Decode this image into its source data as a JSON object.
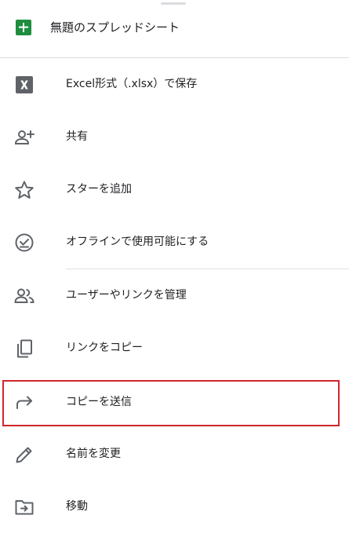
{
  "header": {
    "title": "無題のスプレッドシート",
    "icon": "google-sheets-icon",
    "icon_color": "#1e8e3e"
  },
  "menu": {
    "items": [
      {
        "label": "Excel形式（.xlsx）で保存",
        "icon": "excel-x-icon"
      },
      {
        "label": "共有",
        "icon": "person-add-icon"
      },
      {
        "label": "スターを追加",
        "icon": "star-outline-icon"
      },
      {
        "label": "オフラインで使用可能にする",
        "icon": "offline-check-icon"
      },
      {
        "label": "ユーザーやリンクを管理",
        "icon": "people-icon"
      },
      {
        "label": "リンクをコピー",
        "icon": "copy-icon"
      },
      {
        "label": "コピーを送信",
        "icon": "forward-arrow-icon"
      },
      {
        "label": "名前を変更",
        "icon": "pencil-icon"
      },
      {
        "label": "移動",
        "icon": "move-folder-icon"
      }
    ]
  },
  "highlight": {
    "target": "コピーを送信",
    "color": "#d0262c"
  }
}
